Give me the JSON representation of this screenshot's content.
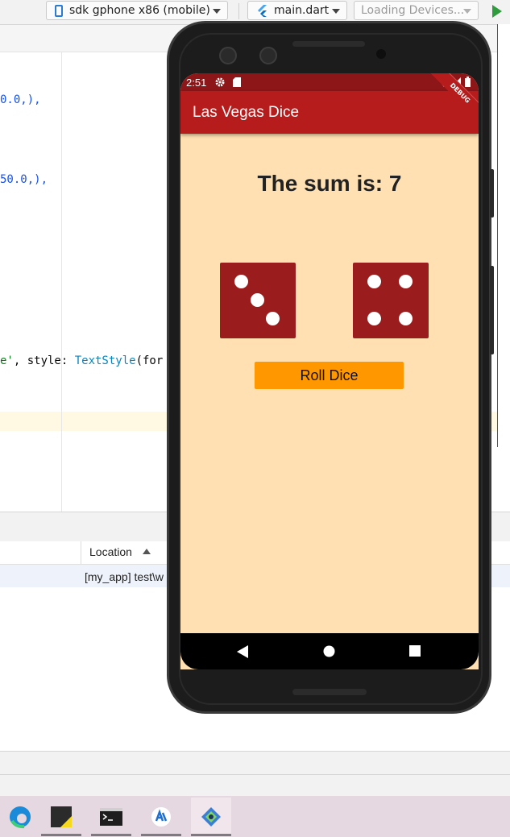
{
  "toolbar": {
    "device_label": "sdk gphone x86 (mobile)",
    "file_label": "main.dart",
    "devices_label": "Loading Devices..."
  },
  "code": {
    "line1": "0.0,),",
    "line2": "50.0,),",
    "line3_str": "e'",
    "line3_mid": ", style: ",
    "line3_class": "TextStyle",
    "line3_end": "(for"
  },
  "panel": {
    "column_header": "Location",
    "row_text": "[my_app] test\\w"
  },
  "phone": {
    "status_time": "2:51",
    "app_title": "Las Vegas Dice",
    "debug_banner": "DEBUG",
    "sum_text": "The sum is: 7",
    "die_left_value": 3,
    "die_right_value": 4,
    "roll_button": "Roll Dice"
  },
  "colors": {
    "app_bar": "#b71c1c",
    "status_bar": "#8c1618",
    "background": "#ffe0b2",
    "die": "#9b1c1c",
    "button": "#ff9800"
  },
  "icons": {
    "toolbar": [
      "phone-icon",
      "flutter-icon",
      "run-icon"
    ],
    "statusbar": [
      "gear-icon",
      "sd-card-icon",
      "wifi-icon",
      "signal-icon",
      "battery-icon"
    ],
    "navbar": [
      "back-icon",
      "home-icon",
      "recents-icon"
    ],
    "taskbar": [
      "edge-icon",
      "sticky-notes-icon",
      "terminal-icon",
      "app-icon",
      "android-studio-icon"
    ]
  }
}
